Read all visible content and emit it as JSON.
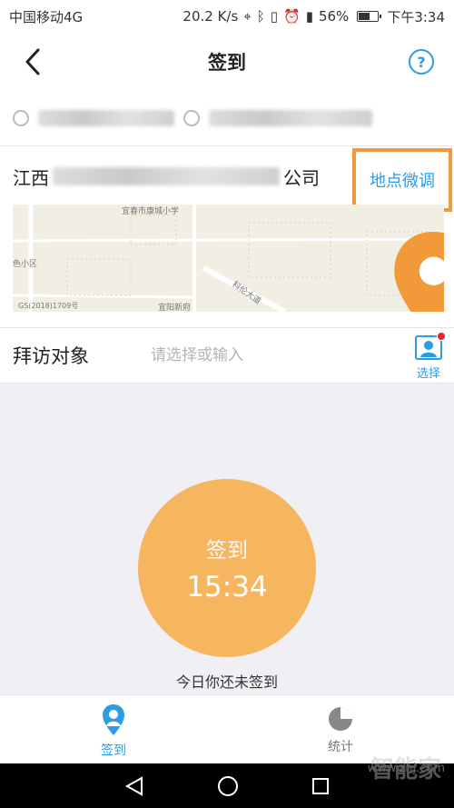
{
  "status_bar": {
    "carrier": "中国移动4G",
    "speed": "20.2 K/s",
    "battery": "56%",
    "time": "下午3:34"
  },
  "header": {
    "title": "签到",
    "help_symbol": "?"
  },
  "location": {
    "name_suffix": "公司",
    "name_prefix": "江西",
    "adjust_label": "地点微调",
    "map_labels": {
      "school": "宜春市康城小学",
      "area": "色小区",
      "road": "科伦大道",
      "gov": "宜阳新府",
      "copyright": "GS(2018)1709号"
    }
  },
  "visit": {
    "label": "拜访对象",
    "placeholder": "请选择或输入",
    "select_label": "选择"
  },
  "checkin": {
    "title": "签到",
    "time": "15:34",
    "status": "今日你还未签到"
  },
  "bottom_nav": {
    "items": [
      {
        "label": "签到",
        "active": true
      },
      {
        "label": "统计",
        "active": false
      }
    ]
  },
  "watermark": {
    "text": "www.znj.com",
    "cn": "智能家"
  },
  "colors": {
    "accent": "#2d9ce6",
    "highlight": "#f29a3a",
    "checkin": "#f6b660",
    "badge": "#ee2222"
  }
}
